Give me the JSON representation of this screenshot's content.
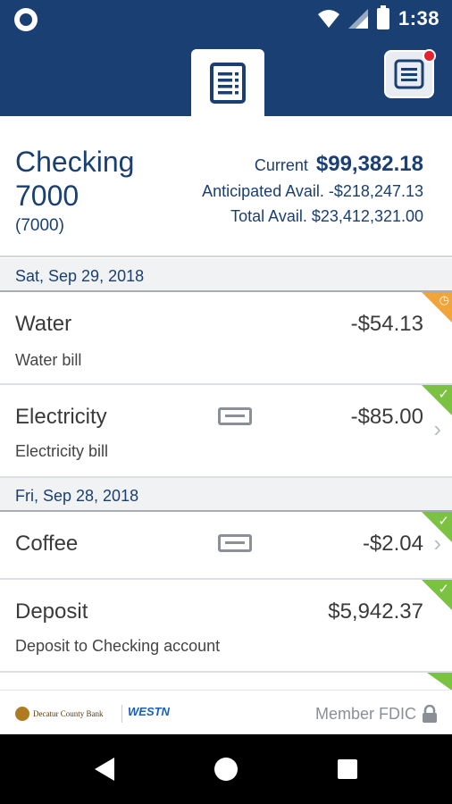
{
  "status_bar": {
    "time": "1:38"
  },
  "account": {
    "name": "Checking 7000",
    "number": "(7000)",
    "current_label": "Current",
    "current_value": "$99,382.18",
    "anticipated": "Anticipated Avail. -$218,247.13",
    "total": "Total Avail. $23,412,321.00"
  },
  "groups": [
    {
      "date": "Sat, Sep 29, 2018",
      "transactions": [
        {
          "title": "Water",
          "amount": "-$54.13",
          "description": "Water bill",
          "status": "pending"
        },
        {
          "title": "Electricity",
          "amount": "-$85.00",
          "description": "Electricity bill",
          "status": "cleared"
        }
      ]
    },
    {
      "date": "Fri, Sep 28, 2018",
      "transactions": [
        {
          "title": "Coffee",
          "amount": "-$2.04",
          "status": "cleared"
        },
        {
          "title": "Deposit",
          "amount": "$5,942.37",
          "description": "Deposit to Checking account",
          "status": "cleared"
        }
      ]
    }
  ],
  "footer": {
    "logo_dcb": "Decatur County Bank",
    "logo_west": "WESTN",
    "fdic": "Member FDIC"
  },
  "colors": {
    "brand": "#1a3f72",
    "cleared": "#7cc242",
    "pending": "#f0a43a"
  }
}
